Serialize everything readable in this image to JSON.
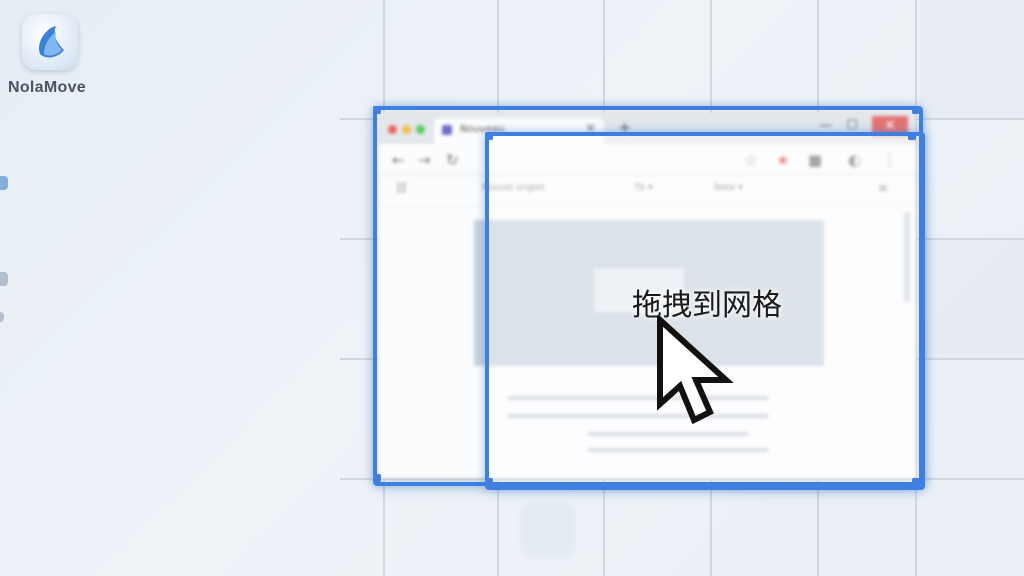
{
  "desktop": {
    "app_name": "NolaMove",
    "app_icon": "nolamove-logo-icon"
  },
  "browser": {
    "tab_title": "Nouveau",
    "bookmarks": [
      "Nouvel onglet",
      "Tb ▾",
      "Note ▾"
    ]
  },
  "overlay": {
    "label": "拖拽到网格",
    "accent_color": "#3f7fe0",
    "cursor_icon": "arrow-cursor-icon"
  }
}
